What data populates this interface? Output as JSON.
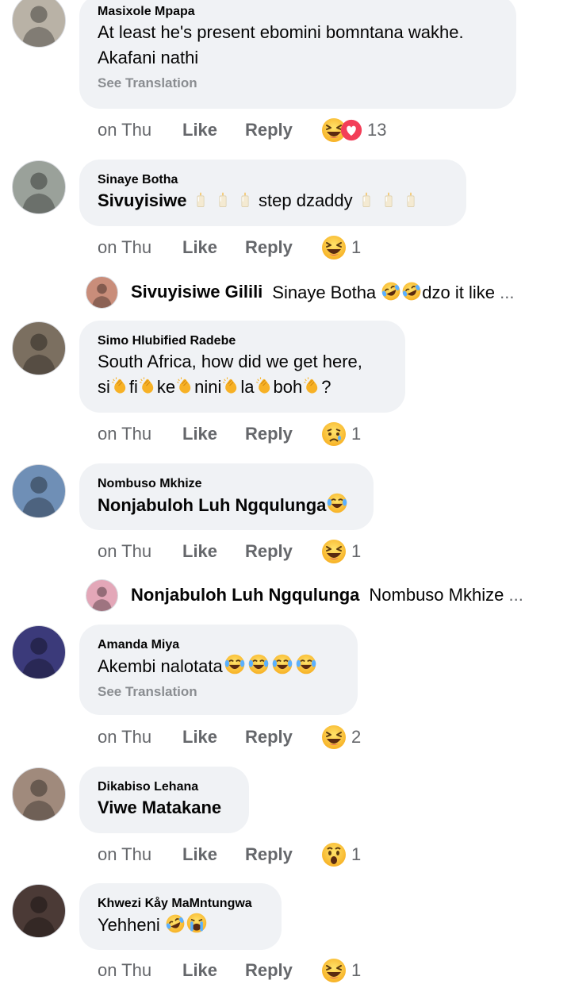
{
  "comments": [
    {
      "author": "Masixole Mpapa",
      "text": "At least he's present ebomini bomntana wakhe. Akafani nathi",
      "translate": "See Translation",
      "time": "on Thu",
      "like": "Like",
      "reply": "Reply",
      "count": "13",
      "avatar_color": "#b9b2a6"
    },
    {
      "author": "Sinaye Botha",
      "text_a": "Sivuyisiwe",
      "text_b": "step dzaddy",
      "time": "on Thu",
      "like": "Like",
      "reply": "Reply",
      "count": "1",
      "avatar_color": "#9aa19a"
    },
    {
      "author": "Simo Hlubified Radebe",
      "line1": "South Africa, how did we get here,",
      "pieces": [
        "si",
        "fi",
        "ke",
        "nini",
        "la",
        "boh",
        "?"
      ],
      "time": "on Thu",
      "like": "Like",
      "reply": "Reply",
      "count": "1",
      "avatar_color": "#7b6f60"
    },
    {
      "author": "Nombuso Mkhize",
      "text": "Nonjabuloh Luh Ngqulunga",
      "time": "on Thu",
      "like": "Like",
      "reply": "Reply",
      "count": "1",
      "avatar_color": "#6f8fb6"
    },
    {
      "author": "Amanda Miya",
      "text": "Akembi nalotata",
      "translate": "See Translation",
      "time": "on Thu",
      "like": "Like",
      "reply": "Reply",
      "count": "2",
      "avatar_color": "#3b3a7a"
    },
    {
      "author": "Dikabiso Lehana",
      "text": "Viwe Matakane",
      "time": "on Thu",
      "like": "Like",
      "reply": "Reply",
      "count": "1",
      "avatar_color": "#a08a7c"
    },
    {
      "author": "Khwezi Kåy MaMntungwa",
      "text": "Yehheni",
      "time": "on Thu",
      "like": "Like",
      "reply": "Reply",
      "count": "1",
      "avatar_color": "#4b3a36"
    }
  ],
  "replies": [
    {
      "name": "Sivuyisiwe Gilili",
      "text_a": "Sinaye Botha",
      "text_b": "dzo it like",
      "ellipsis": "...",
      "avatar_color": "#c98d7a"
    },
    {
      "name": "Nonjabuloh Luh Ngqulunga",
      "text": "Nombuso Mkhize",
      "ellipsis": "...",
      "avatar_color": "#e3a7b8"
    }
  ],
  "icons": {
    "laugh": "laughing-squint-emoji",
    "love": "heart-reaction",
    "cry_laugh": "tears-of-joy-emoji",
    "rofl": "rolling-laughing-emoji",
    "candle": "candle-emoji",
    "clap": "clapping-hands-emoji",
    "sad": "sad-emoji",
    "wow": "wow-emoji",
    "sob": "loudly-crying-emoji"
  }
}
